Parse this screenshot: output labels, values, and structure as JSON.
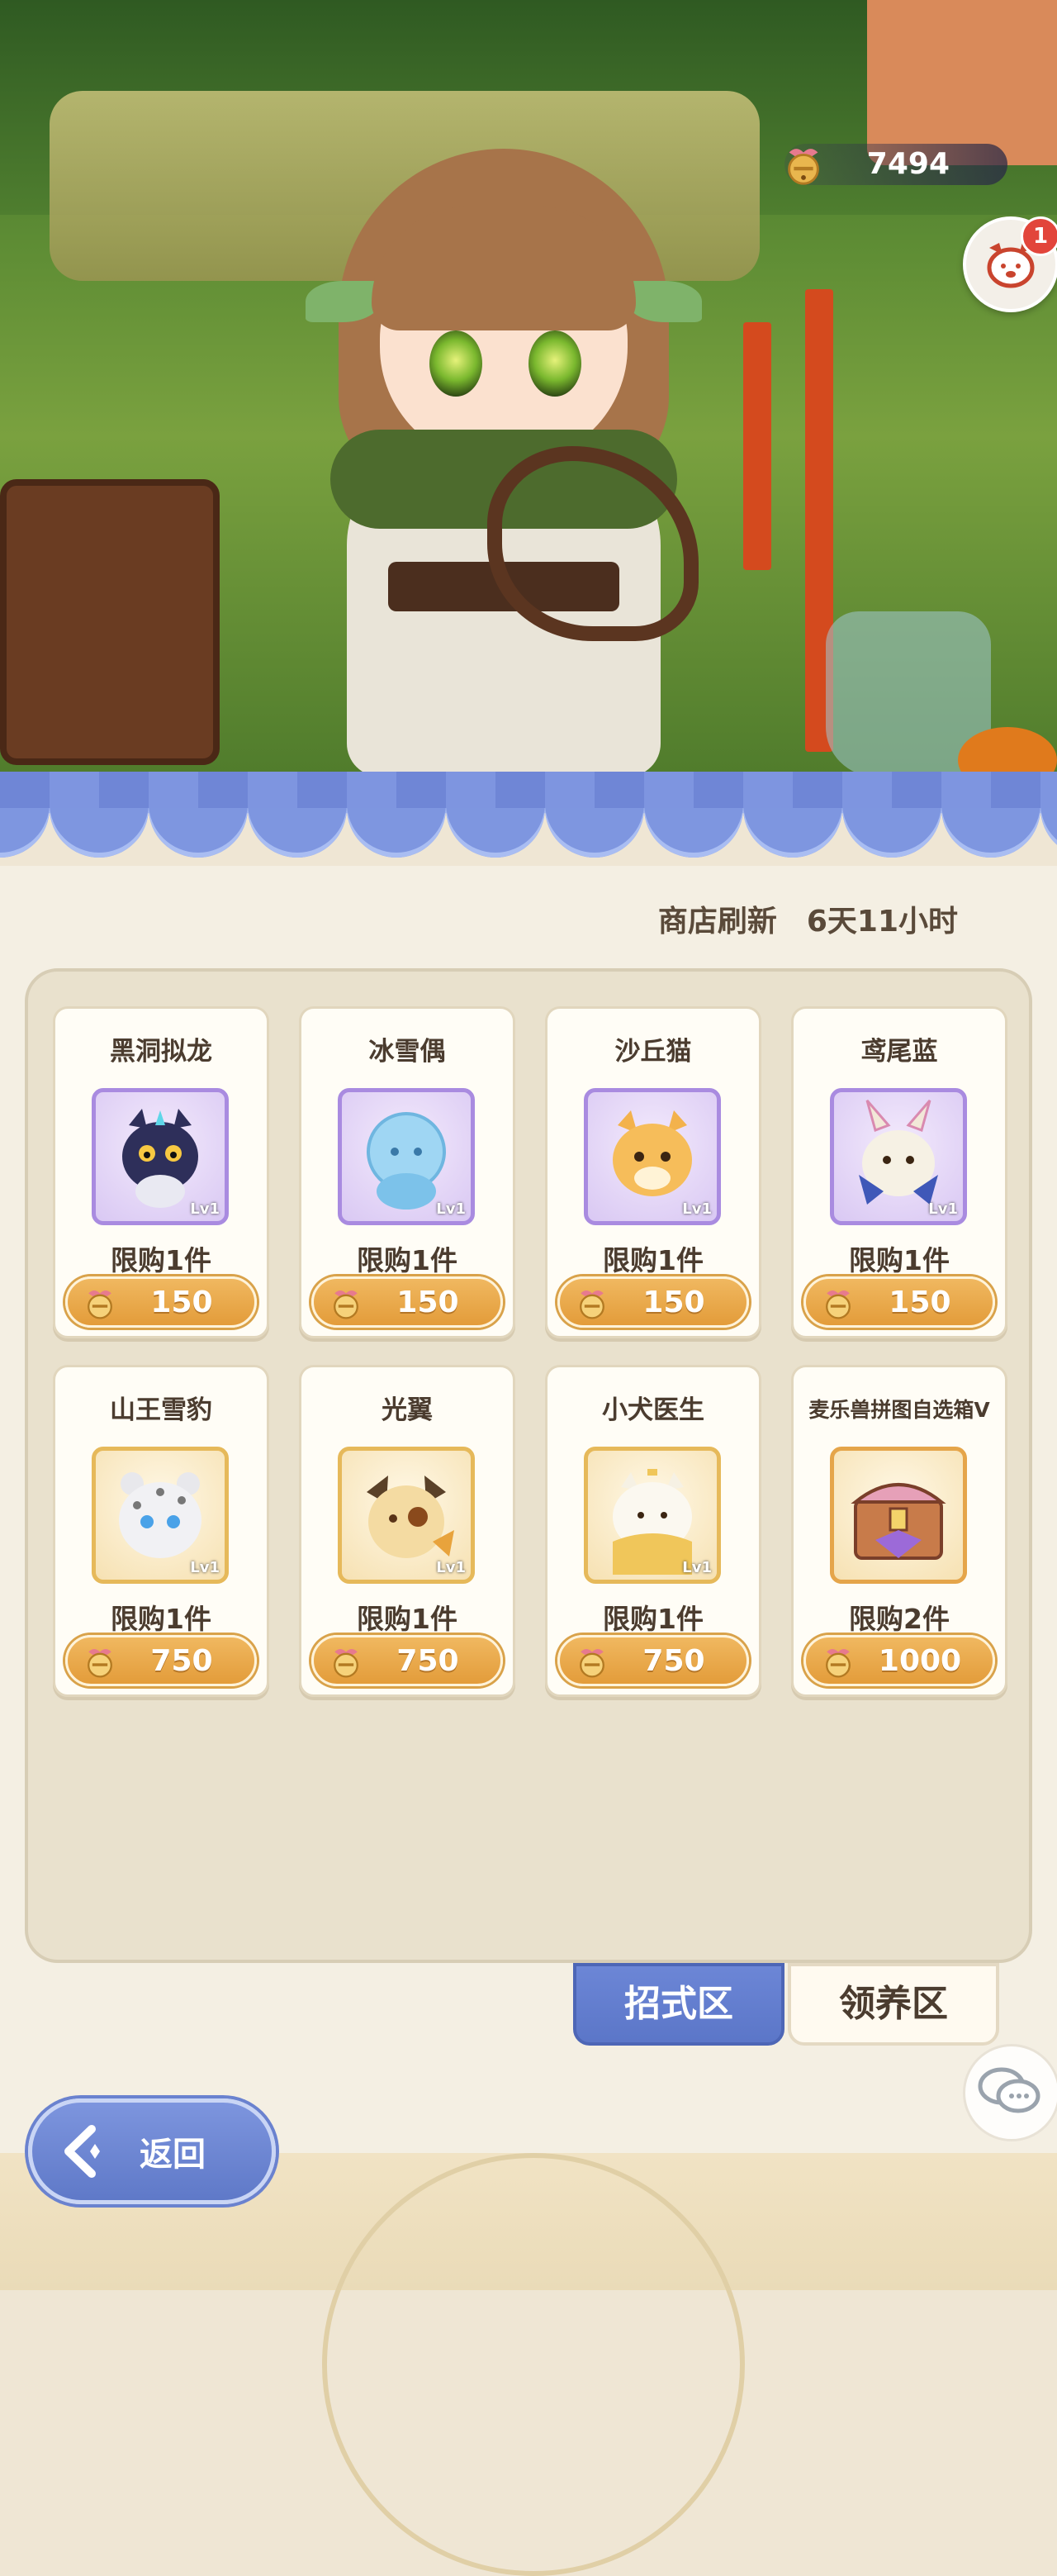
{
  "hud": {
    "currency_value": "7494",
    "notification_count": "1"
  },
  "shop": {
    "refresh_label": "商店刷新",
    "refresh_time": "6天11小时"
  },
  "items": [
    {
      "name": "黑洞拟龙",
      "level": "Lv1",
      "limit": "限购1件",
      "price": "150"
    },
    {
      "name": "冰雪偶",
      "level": "Lv1",
      "limit": "限购1件",
      "price": "150"
    },
    {
      "name": "沙丘猫",
      "level": "Lv1",
      "limit": "限购1件",
      "price": "150"
    },
    {
      "name": "鸢尾蓝",
      "level": "Lv1",
      "limit": "限购1件",
      "price": "150"
    },
    {
      "name": "山王雪豹",
      "level": "Lv1",
      "limit": "限购1件",
      "price": "750"
    },
    {
      "name": "光翼",
      "level": "Lv1",
      "limit": "限购1件",
      "price": "750"
    },
    {
      "name": "小犬医生",
      "level": "Lv1",
      "limit": "限购1件",
      "price": "750"
    },
    {
      "name": "麦乐兽拼图自选箱Ⅴ",
      "limit": "限购2件",
      "price": "1000"
    }
  ],
  "tabs": {
    "active": "招式区",
    "inactive": "领养区"
  },
  "back_button": {
    "label": "返回"
  },
  "colors": {
    "accent_blue": "#5f79c8",
    "price_orange": "#e39c3a",
    "panel_bg": "#f4efe3"
  }
}
